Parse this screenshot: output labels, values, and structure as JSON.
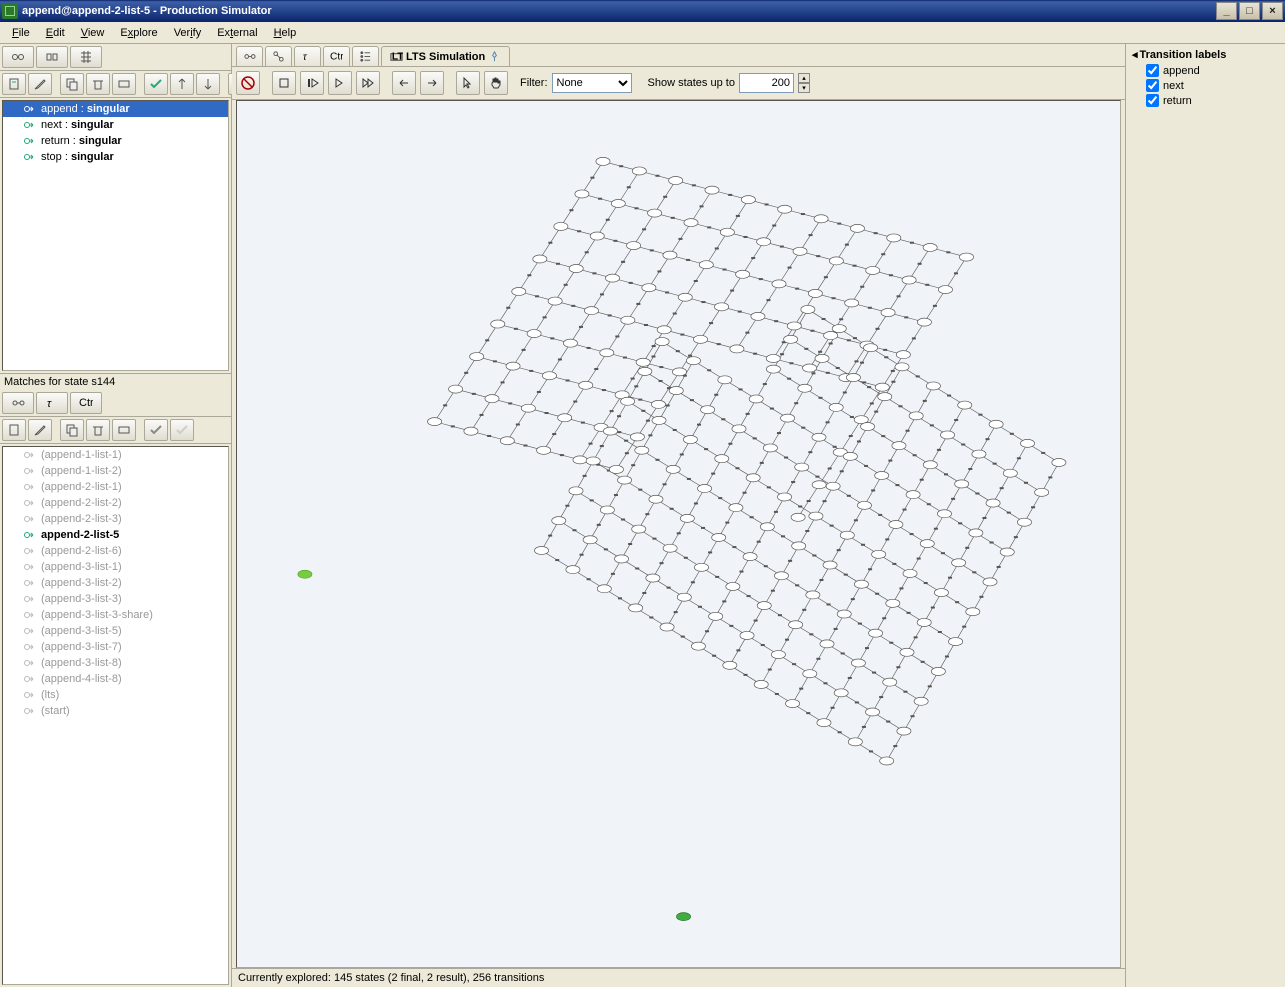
{
  "window": {
    "title": "append@append-2-list-5 - Production Simulator"
  },
  "menu": {
    "file": "File",
    "edit": "Edit",
    "view": "View",
    "explore": "Explore",
    "verify": "Verify",
    "external": "External",
    "help": "Help"
  },
  "rules_tree": [
    {
      "label_left": "append : ",
      "label_right": "singular",
      "selected": true
    },
    {
      "label_left": "next : ",
      "label_right": "singular",
      "selected": false
    },
    {
      "label_left": "return : ",
      "label_right": "singular",
      "selected": false
    },
    {
      "label_left": "stop : ",
      "label_right": "singular",
      "selected": false
    }
  ],
  "matches_label": "Matches for state s144",
  "matches": [
    {
      "label": "(append-1-list-1)",
      "selected": false,
      "dim": true
    },
    {
      "label": "(append-1-list-2)",
      "selected": false,
      "dim": true
    },
    {
      "label": "(append-2-list-1)",
      "selected": false,
      "dim": true
    },
    {
      "label": "(append-2-list-2)",
      "selected": false,
      "dim": true
    },
    {
      "label": "(append-2-list-3)",
      "selected": false,
      "dim": true
    },
    {
      "label": "append-2-list-5",
      "selected": true,
      "dim": false
    },
    {
      "label": "(append-2-list-6)",
      "selected": false,
      "dim": true
    },
    {
      "label": "(append-3-list-1)",
      "selected": false,
      "dim": true
    },
    {
      "label": "(append-3-list-2)",
      "selected": false,
      "dim": true
    },
    {
      "label": "(append-3-list-3)",
      "selected": false,
      "dim": true
    },
    {
      "label": "(append-3-list-3-share)",
      "selected": false,
      "dim": true
    },
    {
      "label": "(append-3-list-5)",
      "selected": false,
      "dim": true
    },
    {
      "label": "(append-3-list-7)",
      "selected": false,
      "dim": true
    },
    {
      "label": "(append-3-list-8)",
      "selected": false,
      "dim": true
    },
    {
      "label": "(append-4-list-8)",
      "selected": false,
      "dim": true
    },
    {
      "label": "(lts)",
      "selected": false,
      "dim": true
    },
    {
      "label": "(start)",
      "selected": false,
      "dim": true
    }
  ],
  "tabs": {
    "lts": "LTS  Simulation"
  },
  "sim": {
    "filter_label": "Filter:",
    "filter_value": "None",
    "show_states_label": "Show states up to",
    "show_states_value": "200"
  },
  "transition_labels": {
    "title": "Transition labels",
    "items": [
      "append",
      "next",
      "return"
    ]
  },
  "status": "Currently explored: 145 states (2 final, 2 result), 256 transitions"
}
